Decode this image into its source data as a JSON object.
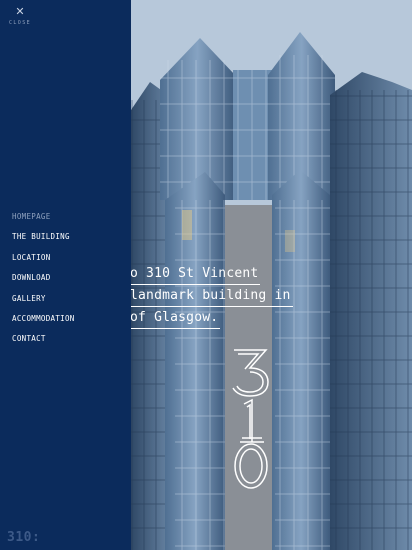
{
  "nav": {
    "close_label": "CLOSE",
    "items": [
      {
        "label": "HOMEPAGE"
      },
      {
        "label": "THE BUILDING"
      },
      {
        "label": "LOCATION"
      },
      {
        "label": "DOWNLOAD"
      },
      {
        "label": "GALLERY"
      },
      {
        "label": "ACCOMMODATION"
      },
      {
        "label": "CONTACT"
      }
    ],
    "logo": "310:"
  },
  "hero": {
    "intro_lines": [
      "o 310 St Vincent",
      "landmark building in",
      "of Glasgow."
    ],
    "number_digits": [
      "3",
      "1",
      "0"
    ]
  },
  "colors": {
    "nav_background": "#0b2b5c",
    "nav_active": "#8ea0bd",
    "text": "#ffffff"
  }
}
